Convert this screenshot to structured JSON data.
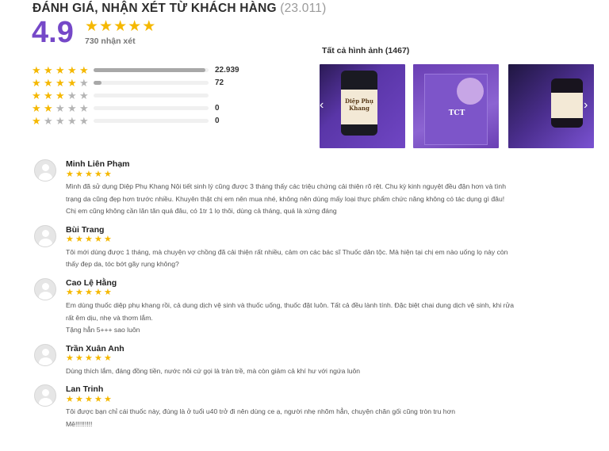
{
  "header": {
    "title": "ĐÁNH GIÁ, NHẬN XÉT TỪ KHÁCH HÀNG",
    "count": "(23.011)"
  },
  "summary": {
    "score": "4.9",
    "stars": 5,
    "review_count_label": "730 nhận xét"
  },
  "breakdown": [
    {
      "stars": 5,
      "count": "22.939",
      "fill": 0.97
    },
    {
      "stars": 4,
      "count": "72",
      "fill": 0.07
    },
    {
      "stars": 3,
      "count": "",
      "fill": 0
    },
    {
      "stars": 2,
      "count": "0",
      "fill": 0
    },
    {
      "stars": 1,
      "count": "0",
      "fill": 0
    }
  ],
  "gallery": {
    "title": "Tất cả hình ảnh (1467)",
    "product_label": "Diệp Phụ Khang",
    "brand": "TCT"
  },
  "icons": {
    "star": "star-icon",
    "arrow_left": "chevron-left-icon",
    "arrow_right": "chevron-right-icon"
  },
  "colors": {
    "accent": "#7548c8",
    "star": "#f5b800",
    "star_off": "#b5b5b5"
  },
  "reviews": [
    {
      "name": "Minh Liên Phạm",
      "lines": [
        "Mình đã sử dụng Diệp Phụ Khang Nội tiết sinh lý cũng được 3 tháng thấy các triệu chứng cải thiện rõ rệt. Chu kỳ kinh nguyệt đều đặn hơn và tình",
        "trạng da cũng đẹp hơn trước nhiều. Khuyên thật chị em nên mua nhé, không nên dùng mấy loại thực phẩm chức năng không có tác dụng gì đâu!",
        "Chị em cũng không cần lăn tăn quá đâu, có 1tr 1 lọ thôi, dùng cả tháng, quá là xứng đáng"
      ]
    },
    {
      "name": "Bùi Trang",
      "lines": [
        "Tôi mới dùng được 1 tháng, mà chuyện vợ chồng đã cải thiện rất nhiều, cảm ơn các bác sĩ Thuốc dân tộc. Mà hiện tại chị em nào uống lọ này còn",
        "thấy đẹp da, tóc bớt gãy rụng không?"
      ]
    },
    {
      "name": "Cao Lệ Hằng",
      "lines": [
        "Em dùng thuốc diệp phụ khang rồi, cả dung dịch vệ sinh và thuốc uống, thuốc đặt luôn. Tất cả đều lành tính. Đặc biệt chai dung dịch vệ sinh, khi rửa",
        "rất êm dịu, nhẹ và thơm lắm.",
        "Tặng hẳn 5+++ sao luôn"
      ]
    },
    {
      "name": "Trần Xuân Anh",
      "lines": [
        "Dùng thích lắm, đáng đồng tiền, nước nôi cứ gọi là tràn trề, mà còn giảm cả khí hư với ngứa luôn"
      ]
    },
    {
      "name": "Lan Trinh",
      "lines": [
        "Tôi được bạn chỉ cái thuốc này, đúng là ở tuổi u40 trở đi nên dùng ce ạ, người nhẹ nhõm hẳn, chuyện chăn gối cũng tròn tru hơn",
        "Mê!!!!!!!!!"
      ]
    }
  ]
}
